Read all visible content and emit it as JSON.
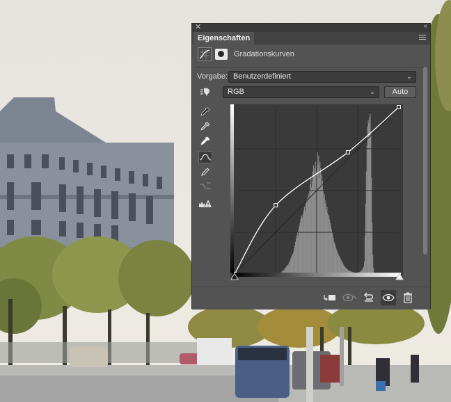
{
  "panel": {
    "tab_label": "Eigenschaften",
    "adjustment_title": "Gradationskurven",
    "preset_label": "Vorgabe:",
    "preset_value": "Benutzerdefiniert",
    "channel_value": "RGB",
    "auto_label": "Auto"
  },
  "curve": {
    "points": [
      [
        0,
        0
      ],
      [
        64,
        105
      ],
      [
        176,
        186
      ],
      [
        255,
        255
      ]
    ]
  },
  "histogram": {
    "comment_levels": [
      0,
      0,
      0,
      0,
      0,
      0,
      0,
      0,
      0,
      0,
      0,
      0,
      0,
      0,
      0,
      0,
      0,
      0,
      0,
      0,
      0,
      0,
      0,
      0,
      0,
      0,
      0,
      0,
      0,
      0,
      0,
      0,
      0,
      0,
      0,
      0,
      0,
      0,
      0,
      0,
      0,
      0,
      0,
      0,
      0,
      0,
      0,
      0,
      0,
      0,
      0,
      0,
      0,
      0,
      0,
      0,
      0,
      0,
      0,
      0,
      0,
      0,
      0,
      0,
      0,
      0,
      0,
      0,
      0,
      0,
      2,
      3,
      2,
      4,
      5,
      6,
      5,
      8,
      9,
      10,
      12,
      14,
      13,
      15,
      18,
      20,
      22,
      25,
      28,
      30,
      32,
      35,
      40,
      45,
      50,
      55,
      60,
      65,
      58,
      70,
      75,
      80,
      85,
      90,
      92,
      88,
      95,
      100,
      105,
      98,
      110,
      115,
      112,
      120,
      125,
      118,
      130,
      140,
      150,
      135,
      145,
      160,
      170,
      155,
      165,
      175,
      160,
      180,
      190,
      170,
      185,
      150,
      175,
      165,
      140,
      155,
      145,
      130,
      120,
      125,
      110,
      115,
      100,
      105,
      95,
      90,
      92,
      85,
      80,
      75,
      70,
      65,
      60,
      55,
      50,
      48,
      45,
      40,
      38,
      35,
      32,
      30,
      28,
      26,
      24,
      22,
      20,
      18,
      16,
      14,
      12,
      11,
      10,
      9,
      8,
      7,
      6,
      6,
      5,
      5,
      4,
      4,
      3,
      3,
      3,
      2,
      2,
      2,
      2,
      2,
      2,
      2,
      3,
      3,
      3,
      4,
      5,
      6,
      8,
      10,
      12,
      20,
      60,
      110,
      160,
      200,
      230,
      240,
      235,
      245,
      250,
      220,
      150,
      80,
      30,
      10,
      0,
      0,
      0,
      0,
      0,
      0,
      0,
      0,
      0,
      0,
      0,
      0,
      0,
      0,
      0,
      0,
      0,
      0,
      0,
      0,
      0,
      0,
      0,
      0,
      0,
      0,
      0,
      0,
      0,
      0,
      0,
      0,
      0,
      0,
      0,
      0,
      0,
      0,
      0,
      0,
      0,
      0,
      0,
      0,
      0,
      0,
      0,
      0,
      0,
      0,
      0,
      0,
      0,
      0,
      0,
      0,
      0,
      0,
      0,
      0,
      0
    ]
  },
  "colors": {
    "panel_bg": "#535353",
    "graph_bg": "#3a3a3a",
    "histogram": "#8c8c8c",
    "curve": "#ffffff"
  }
}
